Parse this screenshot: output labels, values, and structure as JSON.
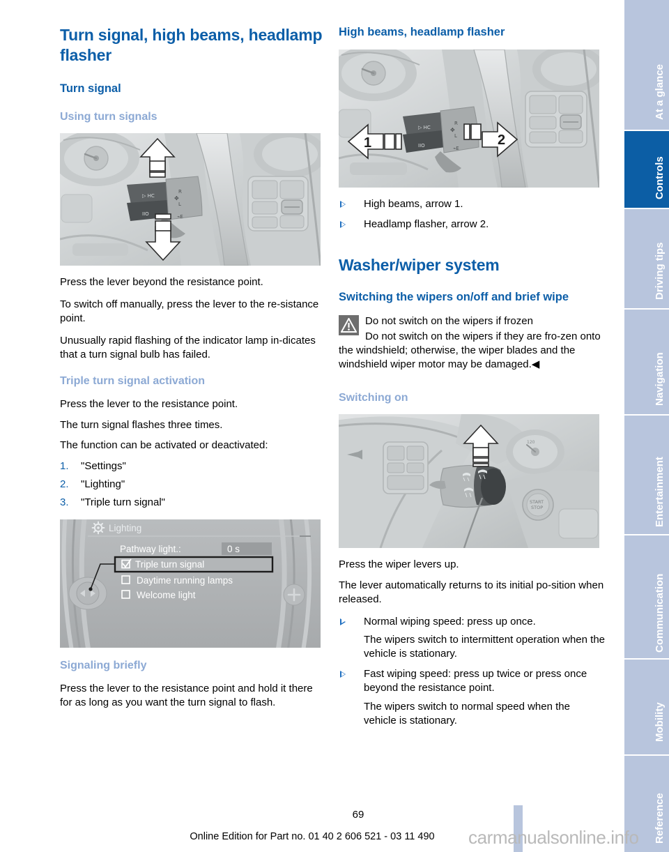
{
  "document": {
    "page_number": "69",
    "footer_note": "Online Edition for Part no. 01 40 2 606 521 - 03 11 490",
    "watermark": "carmanualsonline.info"
  },
  "colors": {
    "heading_blue": "#0c5ea8",
    "subheading_blue": "#8ca9d4",
    "tab_inactive": "#b8c5dd",
    "tab_active": "#0c5ea5",
    "warning_gray": "#6e6e6e"
  },
  "sidebar": {
    "tabs": [
      {
        "label": "At a glance",
        "active": false
      },
      {
        "label": "Controls",
        "active": true
      },
      {
        "label": "Driving tips",
        "active": false
      },
      {
        "label": "Navigation",
        "active": false
      },
      {
        "label": "Entertainment",
        "active": false
      },
      {
        "label": "Communication",
        "active": false
      },
      {
        "label": "Mobility",
        "active": false
      },
      {
        "label": "Reference",
        "active": false
      }
    ]
  },
  "left_column": {
    "chapter_title": "Turn signal, high beams, headlamp flasher",
    "section_turn_signal": "Turn signal",
    "sub_using": "Using turn signals",
    "fig_turn_signal_caption": "turn-signal-lever-photo",
    "p1": "Press the lever beyond the resistance point.",
    "p2": "To switch off manually, press the lever to the re-sistance point.",
    "p3": "Unusually rapid flashing of the indicator lamp in-dicates that a turn signal bulb has failed.",
    "sub_triple": "Triple turn signal activation",
    "p4": "Press the lever to the resistance point.",
    "p5": "The turn signal flashes three times.",
    "p6": "The function can be activated or deactivated:",
    "steps": [
      {
        "num": "1.",
        "text": "\"Settings\""
      },
      {
        "num": "2.",
        "text": "\"Lighting\""
      },
      {
        "num": "3.",
        "text": "\"Triple turn signal\""
      }
    ],
    "idrive": {
      "title": "Lighting",
      "gear_icon": "gear-icon",
      "rows": [
        {
          "label": "Pathway light.:",
          "value": "0 s",
          "type": "value"
        },
        {
          "label": "Triple turn signal",
          "type": "checkbox",
          "checked": true,
          "highlighted": true
        },
        {
          "label": "Daytime running lamps",
          "type": "checkbox",
          "checked": false,
          "highlighted": false
        },
        {
          "label": "Welcome light",
          "type": "checkbox",
          "checked": false,
          "highlighted": false
        }
      ]
    },
    "sub_signaling": "Signaling briefly",
    "p7": "Press the lever to the resistance point and hold it there for as long as you want the turn signal to flash."
  },
  "right_column": {
    "sub_high_beams": "High beams, headlamp flasher",
    "fig_high_beams_caption": "high-beams-lever-photo",
    "arrow_labels": {
      "left": "1",
      "right": "2"
    },
    "bullets_high_beams": [
      "High beams, arrow 1.",
      "Headlamp flasher, arrow 2."
    ],
    "chapter_washer": "Washer/wiper system",
    "sub_switching": "Switching the wipers on/off and brief wipe",
    "warning": {
      "icon": "warning-triangle-icon",
      "title": "Do not switch on the wipers if frozen",
      "text": "Do not switch on the wipers if they are fro-zen onto the windshield; otherwise, the wiper blades and the windshield wiper motor may be damaged.◀"
    },
    "sub_switching_on": "Switching on",
    "fig_wiper_caption": "wiper-lever-photo",
    "p1": "Press the wiper levers up.",
    "p2": "The lever automatically returns to its initial po-sition when released.",
    "bullets_wipers": [
      {
        "main": "Normal wiping speed: press up once.",
        "cont": "The wipers switch to intermittent operation when the vehicle is stationary."
      },
      {
        "main": "Fast wiping speed: press up twice or press once beyond the resistance point.",
        "cont": "The wipers switch to normal speed when the vehicle is stationary."
      }
    ]
  }
}
